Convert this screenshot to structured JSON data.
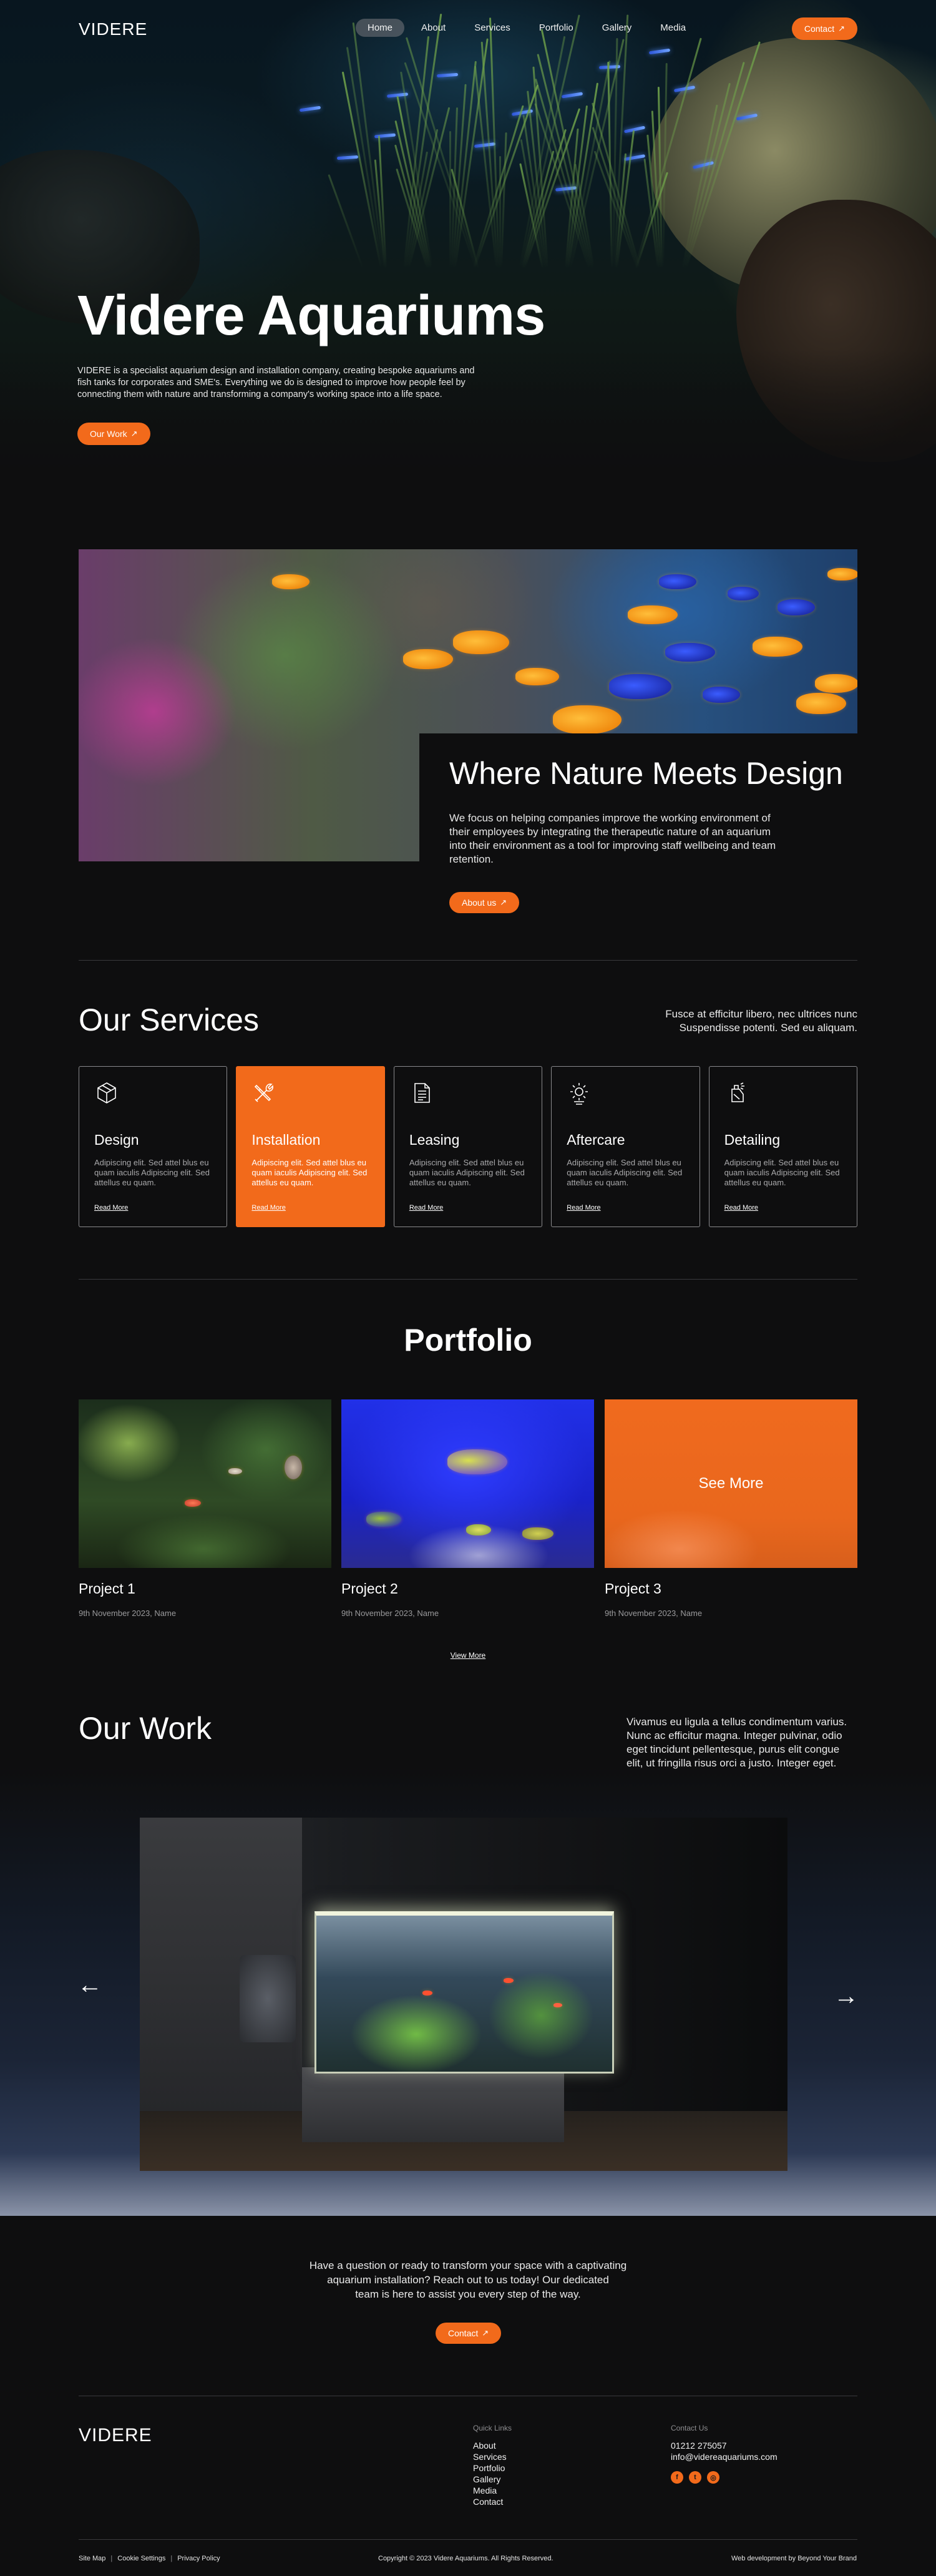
{
  "brand": {
    "logo": "VIDERE",
    "accent": "#f26a1b",
    "background": "#0e0e0f"
  },
  "nav": {
    "items": [
      {
        "label": "Home",
        "active": true
      },
      {
        "label": "About"
      },
      {
        "label": "Services"
      },
      {
        "label": "Portfolio"
      },
      {
        "label": "Gallery"
      },
      {
        "label": "Media"
      }
    ],
    "contact_label": "Contact",
    "arrow_icon": "arrow-up-right-icon"
  },
  "hero": {
    "title": "Videre Aquariums",
    "text": "VIDERE is a specialist aquarium design and installation company, creating bespoke aquariums and fish tanks for corporates and SME's. Everything we do is designed to improve how people feel by connecting them with nature and transforming a company's working space into a life space.",
    "button": "Our Work"
  },
  "nature": {
    "title": "Where Nature Meets Design",
    "text": "We focus on helping companies improve the working environment of their employees by integrating the therapeutic nature of an aquarium into their environment as a tool for improving staff wellbeing and team retention.",
    "button": "About us"
  },
  "services": {
    "title": "Our Services",
    "description": "Fusce at efficitur libero, nec ultrices nunc Suspendisse potenti. Sed eu aliquam.",
    "cards": [
      {
        "title": "Design",
        "text": "Adipiscing elit. Sed attel blus eu quam iaculis Adipiscing elit. Sed attellus eu quam.",
        "link": "Read More",
        "icon": "cube-icon",
        "active": false
      },
      {
        "title": "Installation",
        "text": "Adipiscing elit. Sed attel blus eu quam iaculis Adipiscing elit. Sed attellus eu quam.",
        "link": "Read More",
        "icon": "tools-icon",
        "active": true
      },
      {
        "title": "Leasing",
        "text": "Adipiscing elit. Sed attel blus eu quam iaculis Adipiscing elit. Sed attellus eu quam.",
        "link": "Read More",
        "icon": "document-icon",
        "active": false
      },
      {
        "title": "Aftercare",
        "text": "Adipiscing elit. Sed attel blus eu quam iaculis Adipiscing elit. Sed attellus eu quam.",
        "link": "Read More",
        "icon": "gear-icon",
        "active": false
      },
      {
        "title": "Detailing",
        "text": "Adipiscing elit. Sed attel blus eu quam iaculis Adipiscing elit. Sed attellus eu quam.",
        "link": "Read More",
        "icon": "spray-icon",
        "active": false
      }
    ]
  },
  "portfolio": {
    "title": "Portfolio",
    "projects": [
      {
        "name": "Project 1",
        "date": "9th November 2023, Name"
      },
      {
        "name": "Project 2",
        "date": "9th November 2023, Name"
      },
      {
        "name": "Project 3",
        "date": "9th November 2023, Name",
        "overlay": "See More"
      }
    ],
    "view_more": "View More"
  },
  "work": {
    "title": "Our Work",
    "text": "Vivamus eu ligula a tellus condimentum varius. Nunc ac efficitur magna. Integer pulvinar, odio eget tincidunt pellentesque, purus elit congue elit, ut fringilla risus orci a justo. Integer eget.",
    "prev_icon": "arrow-left-icon",
    "next_icon": "arrow-right-icon"
  },
  "cta": {
    "lines": [
      "Have a question or ready to transform your space with a captivating",
      "aquarium installation? Reach out to us today! Our dedicated",
      "team is here to assist you every step of the way."
    ],
    "button": "Contact"
  },
  "footer": {
    "logo": "VIDERE",
    "quick_links_heading": "Quick Links",
    "quick_links": [
      "About",
      "Services",
      "Portfolio",
      "Gallery",
      "Media",
      "Contact"
    ],
    "contact_heading": "Contact Us",
    "phone": "01212 275057",
    "email": "info@videreaquariums.com",
    "socials": [
      {
        "icon": "facebook-icon",
        "glyph": "f"
      },
      {
        "icon": "twitter-icon",
        "glyph": "t"
      },
      {
        "icon": "instagram-icon",
        "glyph": "◎"
      }
    ],
    "legal": [
      "Site Map",
      "Cookie Settings",
      "Privacy Policy"
    ],
    "copyright": "Copyright © 2023 Videre Aquariums. All Rights Reserved.",
    "credit": "Web development by Beyond Your Brand"
  }
}
